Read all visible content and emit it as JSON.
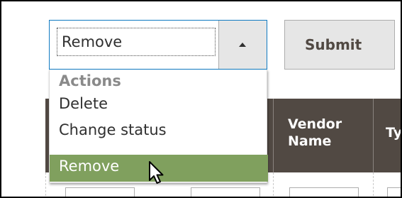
{
  "mass_action": {
    "selected_value": "Remove",
    "submit_label": "Submit",
    "dropdown": {
      "group_label": "Actions",
      "options": [
        "Delete",
        "Change status",
        "Remove"
      ],
      "highlighted_option": "Remove"
    }
  },
  "grid": {
    "columns": [
      {
        "label_line1": "Vendor",
        "label_line2": "Name"
      },
      {
        "label_partial": "Ty"
      }
    ]
  },
  "colors": {
    "header_bg": "#514943",
    "highlight_bg": "#80a05e",
    "focus_border": "#0f7ac2",
    "button_bg": "#e6e6e6"
  },
  "icons": {
    "select_caret": "caret-up-icon",
    "mouse": "mouse-pointer-icon"
  }
}
